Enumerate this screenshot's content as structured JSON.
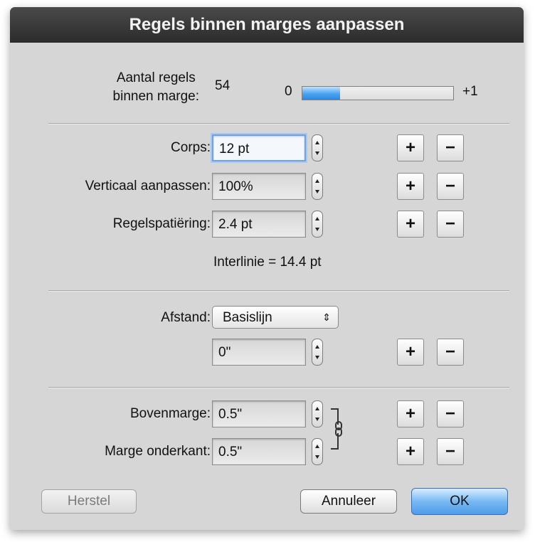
{
  "dialog": {
    "title": "Regels binnen marges aanpassen"
  },
  "line_count": {
    "label_line1": "Aantal regels",
    "label_line2": "binnen marge:",
    "value": "54",
    "range_min": "0",
    "range_max": "+1",
    "fill_fraction": 0.25
  },
  "corps": {
    "label": "Corps:",
    "value": "12 pt"
  },
  "vertical_scale": {
    "label": "Verticaal aanpassen:",
    "value": "100%"
  },
  "line_spacing": {
    "label": "Regelspatiëring:",
    "value": "2.4 pt"
  },
  "leading_info": "Interlinie =  14.4 pt",
  "distance": {
    "label": "Afstand:",
    "selected": "Basislijn",
    "value": "0\""
  },
  "top_margin": {
    "label": "Bovenmarge:",
    "value": "0.5\""
  },
  "bottom_margin": {
    "label": "Marge onderkant:",
    "value": "0.5\""
  },
  "buttons": {
    "plus": "+",
    "minus": "−",
    "reset": "Herstel",
    "cancel": "Annuleer",
    "ok": "OK"
  },
  "colors": {
    "titlebar": "#2c2c2c",
    "window_bg": "#d6d6d6",
    "default_button": "#4f9ce8"
  },
  "icons": {
    "stepper": "up-down-stepper-icon",
    "link": "chain-link-icon",
    "popup_arrows": "up-down-arrows-icon"
  }
}
